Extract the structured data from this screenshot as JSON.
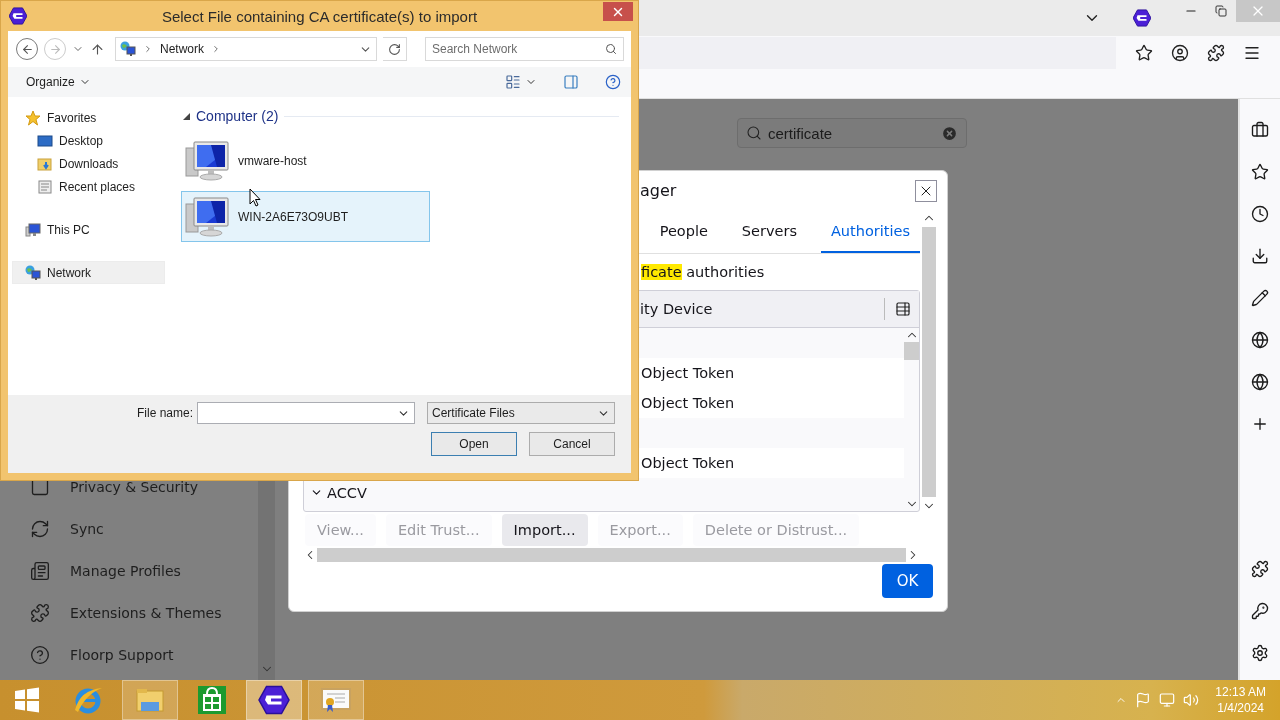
{
  "browser": {
    "search": {
      "value": "certificate"
    },
    "settings_nav": [
      {
        "label": "Privacy & Security"
      },
      {
        "label": "Sync"
      },
      {
        "label": "Manage Profiles"
      },
      {
        "label": "Extensions & Themes"
      },
      {
        "label": "Floorp Support"
      }
    ]
  },
  "certificate_manager": {
    "title": "ager",
    "tabs": [
      {
        "label": "People",
        "selected": false
      },
      {
        "label": "Servers",
        "selected": false
      },
      {
        "label": "Authorities",
        "selected": true
      }
    ],
    "description": {
      "highlight": "ficate",
      "text": "authorities"
    },
    "column": "ity Device",
    "rows": [
      {
        "kind": "blank"
      },
      {
        "kind": "token",
        "label": "Object Token"
      },
      {
        "kind": "token",
        "label": "Object Token"
      },
      {
        "kind": "blank"
      },
      {
        "kind": "token",
        "label": "Object Token"
      },
      {
        "kind": "group",
        "label": "ACCV",
        "expanded": true
      }
    ],
    "buttons": [
      {
        "label": "View...",
        "disabled": true
      },
      {
        "label": "Edit Trust...",
        "disabled": true
      },
      {
        "label": "Import...",
        "disabled": false
      },
      {
        "label": "Export...",
        "disabled": true
      },
      {
        "label": "Delete or Distrust...",
        "disabled": true
      }
    ],
    "ok": "OK"
  },
  "file_dialog": {
    "title": "Select File containing CA certificate(s) to import",
    "address": "Network",
    "search_placeholder": "Search Network",
    "organize": "Organize",
    "nav": [
      {
        "kind": "favorites",
        "label": "Favorites",
        "selected": false
      },
      {
        "kind": "desktop",
        "label": "Desktop",
        "selected": false
      },
      {
        "kind": "downloads",
        "label": "Downloads",
        "selected": false
      },
      {
        "kind": "recent",
        "label": "Recent places",
        "selected": false
      },
      {
        "kind": "pc",
        "label": "This PC",
        "selected": false
      },
      {
        "kind": "network",
        "label": "Network",
        "selected": true
      }
    ],
    "group": {
      "label": "Computer (2)",
      "expanded": true
    },
    "items": [
      {
        "label": "vmware-host",
        "selected": false
      },
      {
        "label": "WIN-2A6E73O9UBT",
        "selected": true
      }
    ],
    "file_name_label": "File name:",
    "file_type": "Certificate Files",
    "buttons": [
      {
        "label": "Open",
        "default": true
      },
      {
        "label": "Cancel",
        "default": false
      }
    ]
  },
  "taskbar": {
    "apps": [
      {
        "kind": "start",
        "open": false,
        "selected": false
      },
      {
        "kind": "ie",
        "open": false,
        "selected": false
      },
      {
        "kind": "explorer",
        "open": true,
        "selected": false
      },
      {
        "kind": "store",
        "open": false,
        "selected": false
      },
      {
        "kind": "floorp",
        "open": true,
        "selected": true
      },
      {
        "kind": "certificate",
        "open": true,
        "selected": false
      }
    ],
    "time": "12:13 AM",
    "date": "1/4/2024"
  }
}
